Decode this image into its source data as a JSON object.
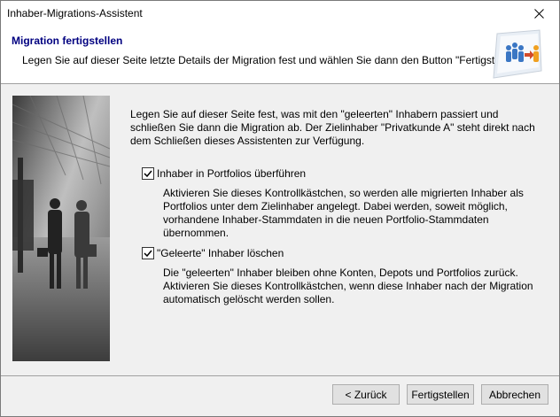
{
  "window": {
    "title": "Inhaber-Migrations-Assistent"
  },
  "header": {
    "title": "Migration fertigstellen",
    "subtitle": "Legen Sie auf dieser Seite letzte Details der Migration fest und wählen Sie dann den Button \"Fertigstellen\"."
  },
  "intro": "Legen Sie auf dieser Seite fest, was mit den \"geleerten\" Inhabern passiert und schließen Sie dann die Migration ab. Der Zielinhaber \"Privatkunde A\" steht direkt nach dem Schließen dieses Assistenten zur Verfügung.",
  "options": [
    {
      "label": "Inhaber in Portfolios überführen",
      "checked": true,
      "description": "Aktivieren Sie dieses Kontrollkästchen, so werden alle migrierten Inhaber als Portfolios unter dem Zielinhaber angelegt. Dabei werden, soweit möglich, vorhandene Inhaber-Stammdaten in die neuen Portfolio-Stammdaten übernommen."
    },
    {
      "label": "\"Geleerte\" Inhaber löschen",
      "checked": true,
      "description": "Die \"geleerten\" Inhaber bleiben ohne Konten, Depots und Portfolios zurück. Aktivieren Sie dieses Kontrollkästchen, wenn diese Inhaber nach der Migration automatisch gelöscht werden sollen."
    }
  ],
  "buttons": {
    "back": "< Zurück",
    "finish": "Fertigstellen",
    "cancel": "Abbrechen"
  }
}
